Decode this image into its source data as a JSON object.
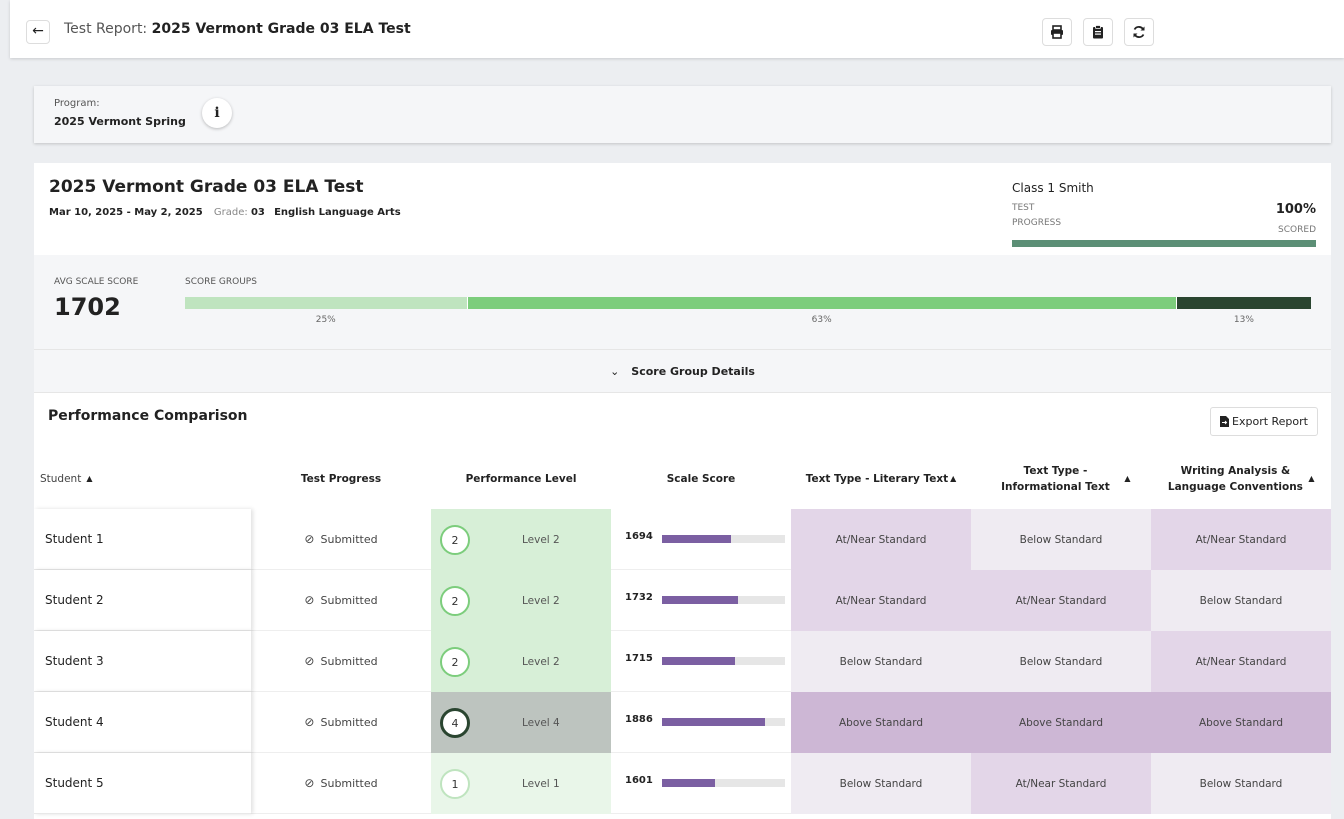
{
  "header": {
    "back_icon": "arrow-left-icon",
    "title_prefix": "Test Report:",
    "title": "2025 Vermont Grade 03 ELA Test",
    "tools": [
      "printer-icon",
      "clipboard-icon",
      "refresh-icon"
    ]
  },
  "program": {
    "label": "Program:",
    "value": "2025 Vermont Spring",
    "info_icon": "info-icon"
  },
  "test": {
    "title": "2025 Vermont Grade 03 ELA Test",
    "dates": "Mar 10, 2025 - May 2, 2025",
    "grade_label": "Grade:",
    "grade": "03",
    "subject": "English Language Arts",
    "class_name": "Class 1 Smith",
    "progress_label_1": "TEST",
    "progress_label_2": "PROGRESS",
    "progress_pct": "100%",
    "progress_status": "SCORED",
    "progress_value": 1.0
  },
  "scores": {
    "avg_label": "AVG SCALE SCORE",
    "avg_value": "1702",
    "groups_label": "SCORE GROUPS",
    "groups": [
      {
        "pct_label": "25%",
        "value": 25,
        "color": "#bfe4bf"
      },
      {
        "pct_label": "63%",
        "value": 63,
        "color": "#7ccd7c"
      },
      {
        "pct_label": "13%",
        "value": 12,
        "color": "#2a4530"
      }
    ]
  },
  "score_group_details": {
    "label": "Score Group Details",
    "icon": "chevron-down-icon"
  },
  "performance": {
    "title": "Performance Comparison",
    "export_label": "Export Report",
    "export_icon": "file-export-icon"
  },
  "table": {
    "headers": {
      "student": "Student",
      "progress": "Test Progress",
      "level": "Performance Level",
      "scale": "Scale Score",
      "literary": "Text Type - Literary Text",
      "informational": "Text Type - Informational Text",
      "writing": "Writing Analysis & Language Conventions"
    },
    "level_styles": {
      "1": {
        "bg": "#e9f6e9",
        "ring": "#bfe4bf"
      },
      "2": {
        "bg": "#d7efd7",
        "ring": "#7ccd7c"
      },
      "4": {
        "bg": "#bdc4bf",
        "ring": "#2a4530"
      }
    },
    "standard_colors": {
      "Above Standard": "#cdb7d5",
      "At/Near Standard": "#e3d6e8",
      "Below Standard": "#efebf2"
    },
    "scale_range": [
      1300,
      2000
    ],
    "rows": [
      {
        "student": "Student 1",
        "progress": "Submitted",
        "level_num": "2",
        "level": "Level 2",
        "scale": "1694",
        "scale_value": 1694,
        "literary": "At/Near Standard",
        "informational": "Below Standard",
        "writing": "At/Near Standard"
      },
      {
        "student": "Student 2",
        "progress": "Submitted",
        "level_num": "2",
        "level": "Level 2",
        "scale": "1732",
        "scale_value": 1732,
        "literary": "At/Near Standard",
        "informational": "At/Near Standard",
        "writing": "Below Standard"
      },
      {
        "student": "Student 3",
        "progress": "Submitted",
        "level_num": "2",
        "level": "Level 2",
        "scale": "1715",
        "scale_value": 1715,
        "literary": "Below Standard",
        "informational": "Below Standard",
        "writing": "At/Near Standard"
      },
      {
        "student": "Student 4",
        "progress": "Submitted",
        "level_num": "4",
        "level": "Level 4",
        "scale": "1886",
        "scale_value": 1886,
        "literary": "Above Standard",
        "informational": "Above Standard",
        "writing": "Above Standard"
      },
      {
        "student": "Student 5",
        "progress": "Submitted",
        "level_num": "1",
        "level": "Level 1",
        "scale": "1601",
        "scale_value": 1601,
        "literary": "Below Standard",
        "informational": "At/Near Standard",
        "writing": "Below Standard"
      }
    ]
  }
}
